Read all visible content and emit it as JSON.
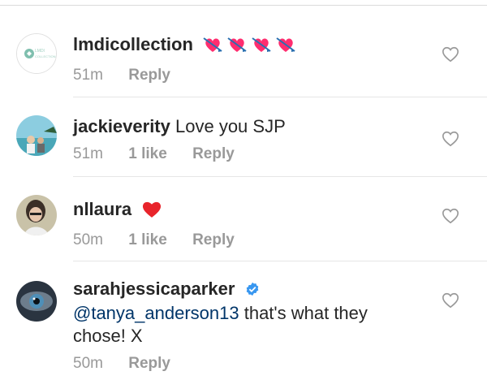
{
  "comments": [
    {
      "username": "lmdicollection",
      "text": "",
      "emoji": [
        "heart-with-arrow-emoji",
        "heart-with-arrow-emoji",
        "heart-with-arrow-emoji",
        "heart-with-arrow-emoji"
      ],
      "time": "51m",
      "likes": "",
      "reply": "Reply",
      "avatar_logo_text": "LMDI COLLECTION"
    },
    {
      "username": "jackieverity",
      "text": "Love you SJP",
      "time": "51m",
      "likes": "1 like",
      "reply": "Reply"
    },
    {
      "username": "nllaura",
      "text": "",
      "emoji": [
        "red-heart-emoji"
      ],
      "time": "50m",
      "likes": "1 like",
      "reply": "Reply"
    },
    {
      "username": "sarahjessicaparker",
      "verified": true,
      "mention": "@tanya_anderson13",
      "text_line1": " that's what they",
      "text_line2": "chose! X",
      "time": "50m",
      "likes": "",
      "reply": "Reply"
    }
  ],
  "colors": {
    "username": "#262626",
    "meta": "#999999",
    "mention": "#003569",
    "verified": "#3897f0",
    "emoji_heart": "#ff2d6f",
    "red_heart": "#e8242b"
  }
}
